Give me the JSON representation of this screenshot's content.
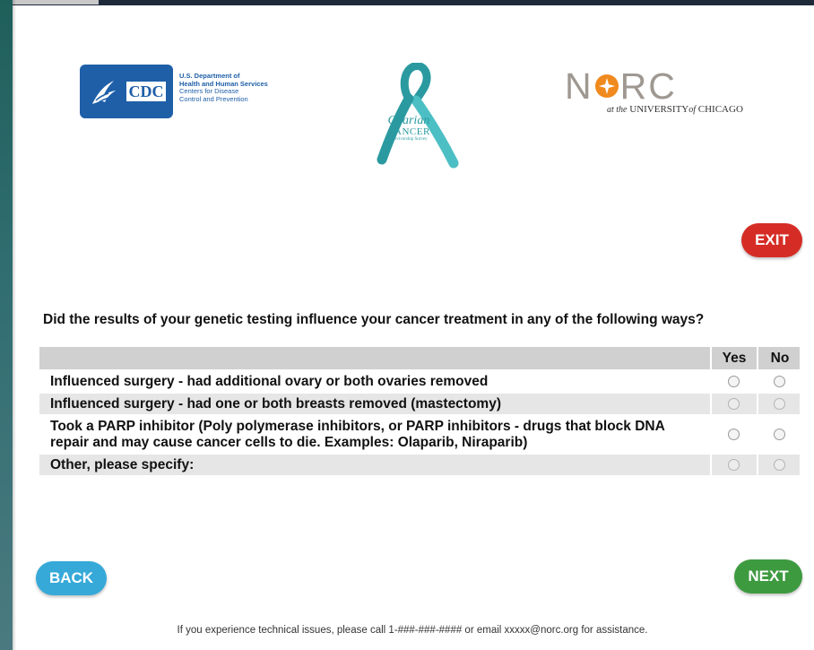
{
  "logos": {
    "cdc": {
      "badge_text": "CDC",
      "lines": [
        "U.S. Department of",
        "Health and Human Services",
        "Centers for Disease",
        "Control and Prevention"
      ]
    },
    "ribbon": {
      "line1": "Ovarian",
      "line2": "CANCER",
      "line3": "Survivorship Survey"
    },
    "norc": {
      "wordmark": "NORC",
      "sub_prefix": "at the",
      "sub_main": "UNIVERSITY",
      "sub_of": "of",
      "sub_end": "CHICAGO"
    }
  },
  "buttons": {
    "exit": "EXIT",
    "back": "BACK",
    "next": "NEXT"
  },
  "question": "Did the results of your genetic testing influence your cancer treatment in any of the following ways?",
  "grid": {
    "columns": [
      "Yes",
      "No"
    ],
    "rows": [
      {
        "label": "Influenced surgery - had additional ovary or both ovaries removed"
      },
      {
        "label": "Influenced surgery - had one or both breasts removed (mastectomy)"
      },
      {
        "label": "Took a PARP inhibitor (Poly polymerase inhibitors, or PARP inhibitors - drugs that block DNA repair and may cause cancer cells to die. Examples: Olaparib, Niraparib)"
      },
      {
        "label": "Other, please specify:"
      }
    ]
  },
  "footer": "If you experience technical issues, please call 1-###-###-#### or email xxxxx@norc.org for assistance.",
  "colors": {
    "exit": "#d52d25",
    "back": "#36a9d9",
    "next": "#3d9a3f",
    "cdc_blue": "#1e5fa8",
    "ribbon_teal": "#2a9aa0",
    "norc_orange": "#f08a1e"
  }
}
